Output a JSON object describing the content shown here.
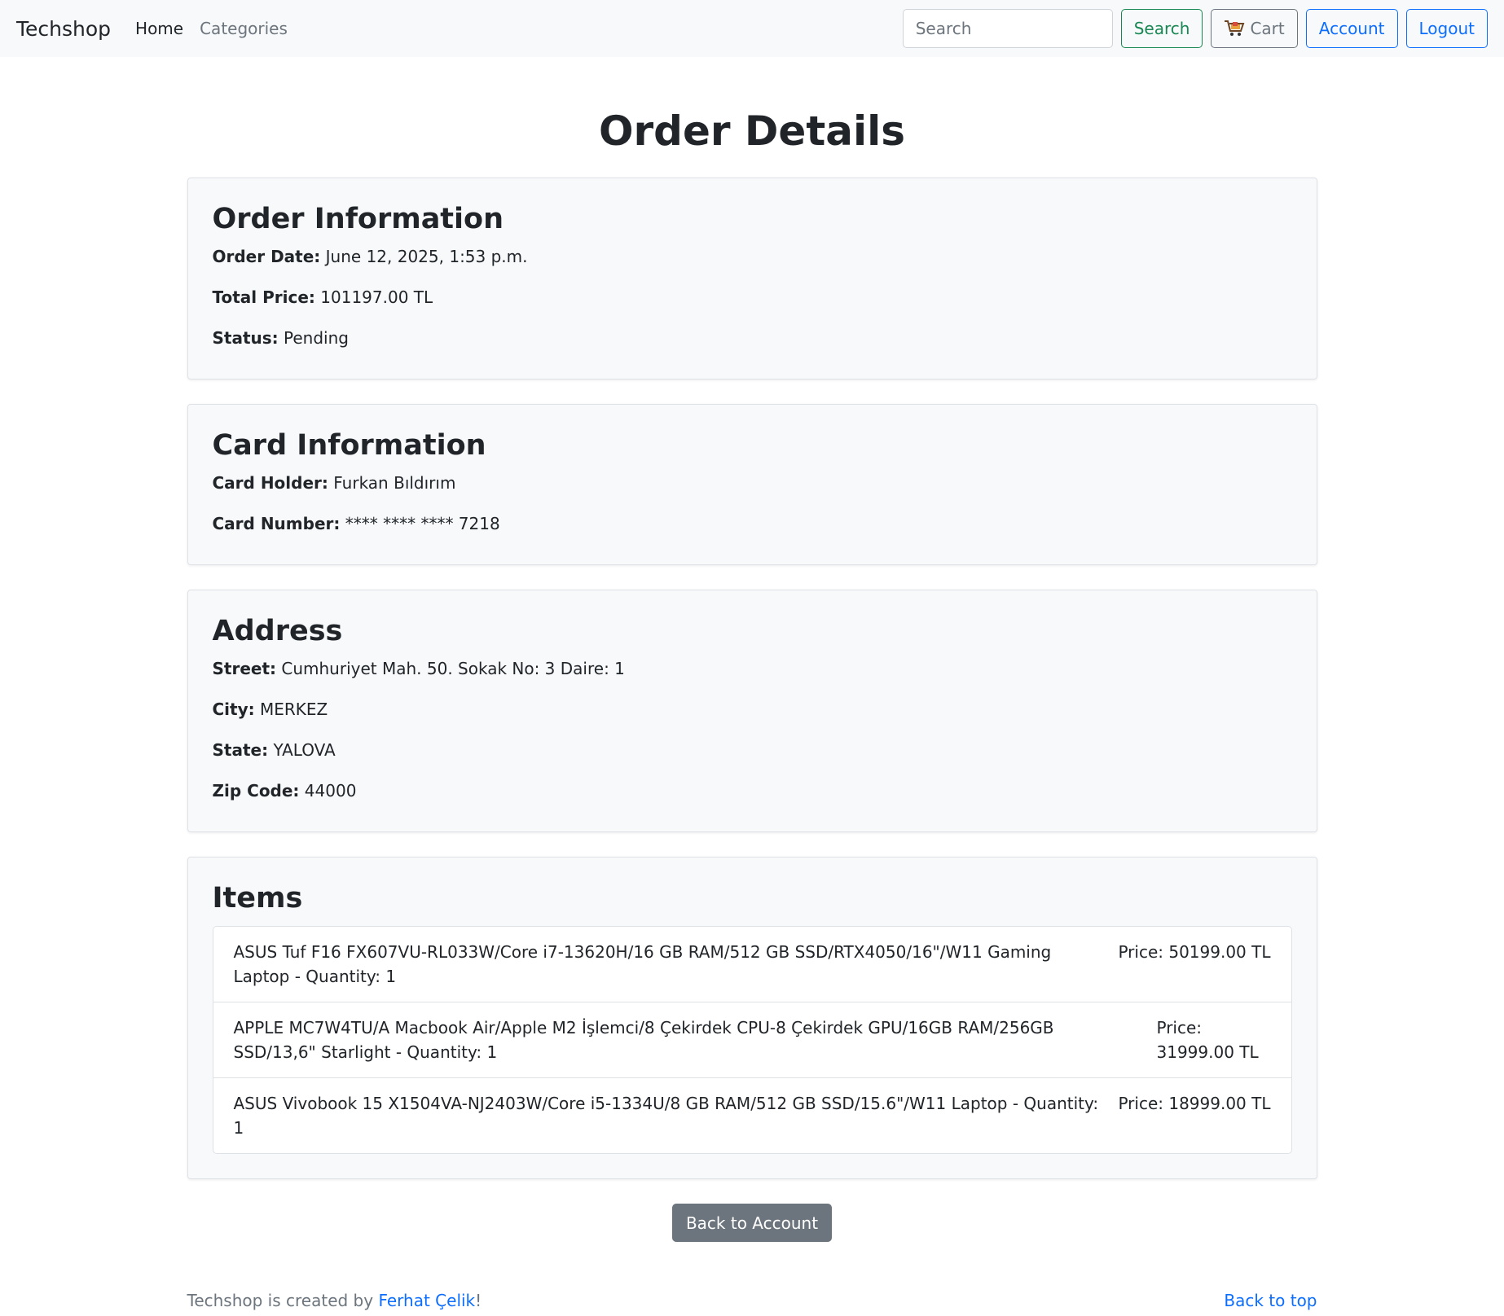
{
  "navbar": {
    "brand": "Techshop",
    "links": [
      {
        "label": "Home"
      },
      {
        "label": "Categories"
      }
    ],
    "search_placeholder": "Search",
    "search_button": "Search",
    "cart_button": "Cart",
    "account_button": "Account",
    "logout_button": "Logout"
  },
  "page": {
    "title": "Order Details"
  },
  "order_info": {
    "heading": "Order Information",
    "date_label": "Order Date:",
    "date_value": "June 12, 2025, 1:53 p.m.",
    "total_label": "Total Price:",
    "total_value": "101197.00 TL",
    "status_label": "Status:",
    "status_value": "Pending"
  },
  "card_info": {
    "heading": "Card Information",
    "holder_label": "Card Holder:",
    "holder_value": "Furkan Bıldırım",
    "number_label": "Card Number:",
    "number_value": "**** **** **** 7218"
  },
  "address": {
    "heading": "Address",
    "street_label": "Street:",
    "street_value": "Cumhuriyet Mah. 50. Sokak No: 3 Daire: 1",
    "city_label": "City:",
    "city_value": "MERKEZ",
    "state_label": "State:",
    "state_value": "YALOVA",
    "zip_label": "Zip Code:",
    "zip_value": "44000"
  },
  "items": {
    "heading": "Items",
    "list": [
      {
        "name": "ASUS Tuf F16 FX607VU-RL033W/Core i7-13620H/16 GB RAM/512 GB SSD/RTX4050/16\"/W11 Gaming Laptop - Quantity: 1",
        "price": "Price: 50199.00 TL"
      },
      {
        "name": "APPLE MC7W4TU/A Macbook Air/Apple M2 İşlemci/8 Çekirdek CPU-8 Çekirdek GPU/16GB RAM/256GB SSD/13,6\" Starlight - Quantity: 1",
        "price": "Price: 31999.00 TL"
      },
      {
        "name": "ASUS Vivobook 15 X1504VA-NJ2403W/Core i5-1334U/8 GB RAM/512 GB SSD/15.6\"/W11 Laptop - Quantity: 1",
        "price": "Price: 18999.00 TL"
      }
    ]
  },
  "back_button": "Back to Account",
  "footer": {
    "prefix": "Techshop is created by ",
    "author": "Ferhat Çelik",
    "suffix": "!",
    "back_to_top": "Back to top"
  },
  "icons": {
    "cart": "cart-icon"
  }
}
